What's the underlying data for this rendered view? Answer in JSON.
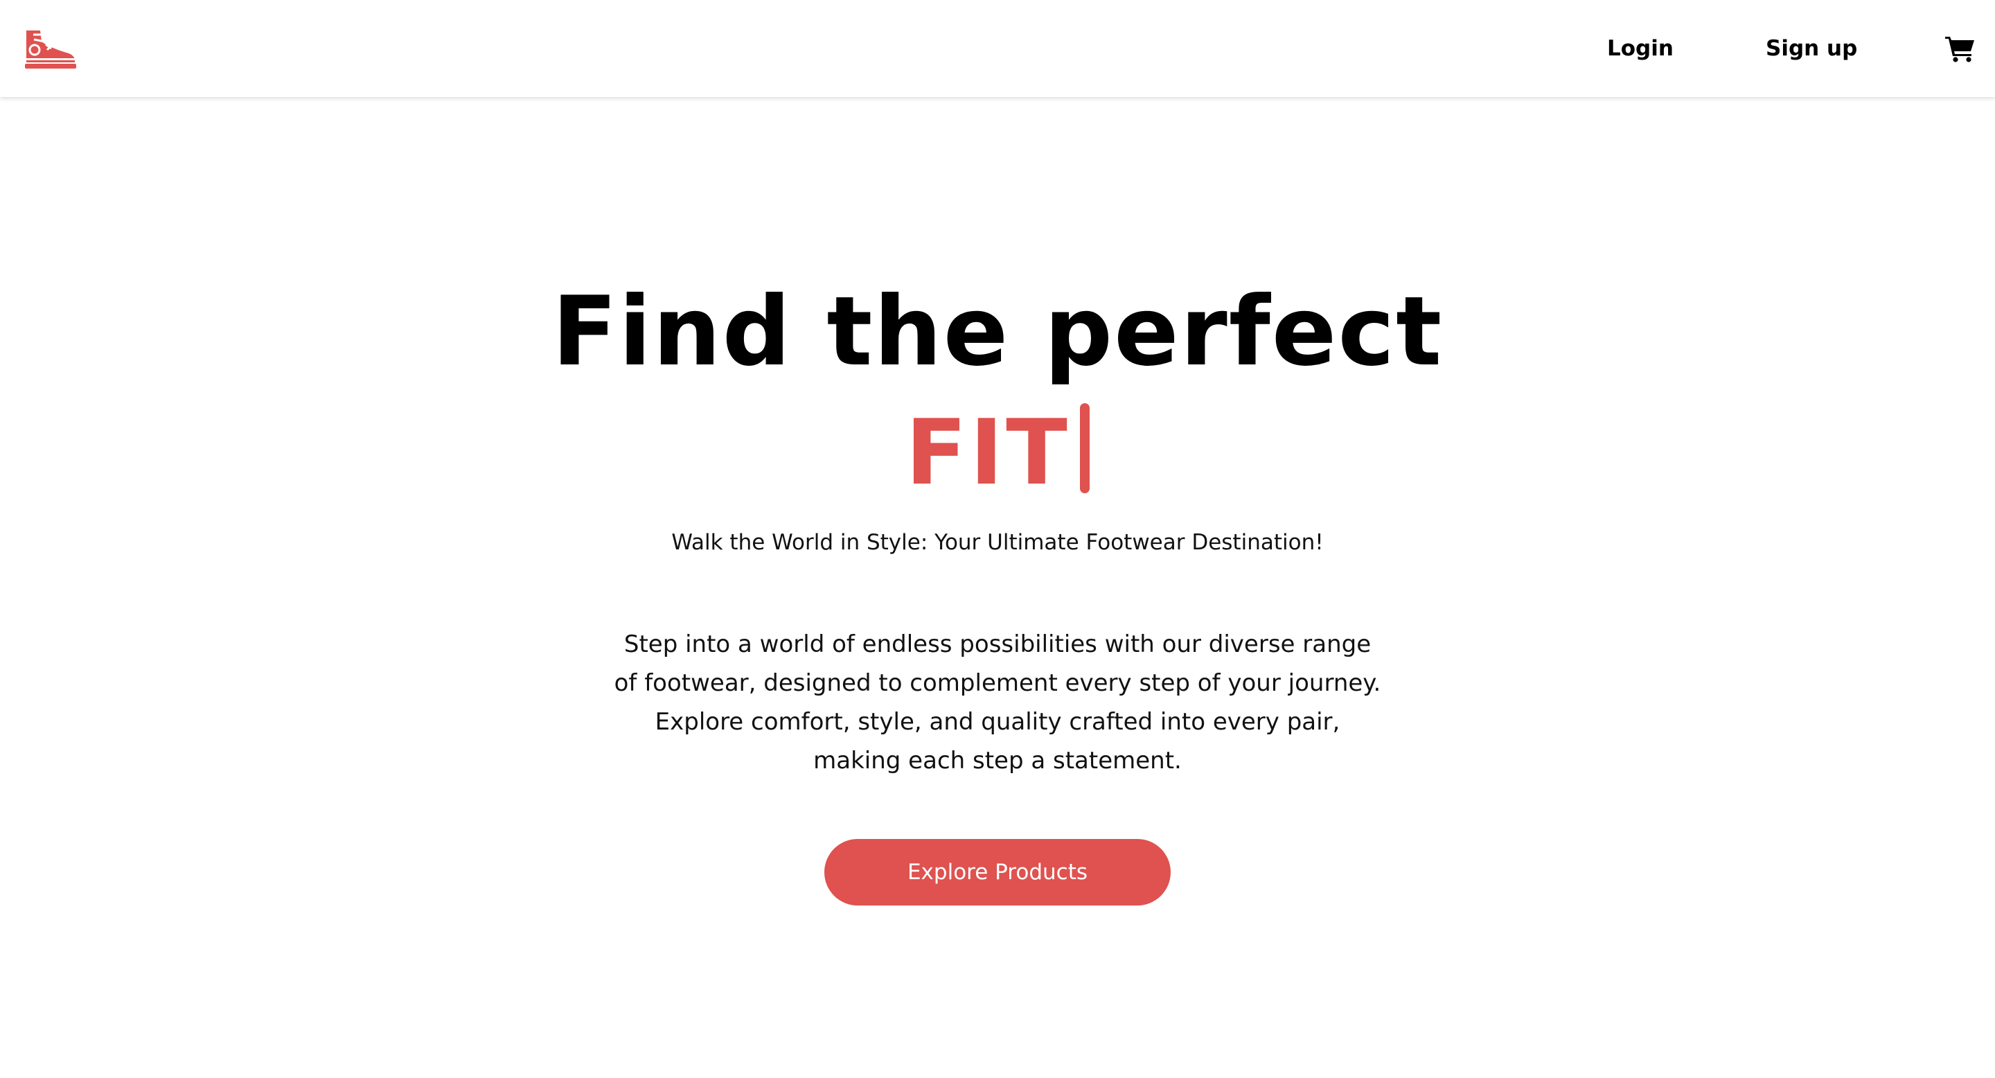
{
  "navbar": {
    "logo_icon": "sneaker-icon",
    "login_label": "Login",
    "signup_label": "Sign up",
    "cart_icon": "shopping-cart-icon"
  },
  "hero": {
    "headline": "Find the perfect",
    "typed_word": "FIT",
    "tagline": "Walk the World in Style: Your Ultimate Footwear Destination!",
    "description": "Step into a world of endless possibilities with our diverse range of footwear, designed to complement every step of your journey. Explore comfort, style, and quality crafted into every pair, making each step a statement.",
    "cta_label": "Explore Products"
  },
  "colors": {
    "accent": "#df524f",
    "text": "#000000",
    "background": "#ffffff"
  }
}
